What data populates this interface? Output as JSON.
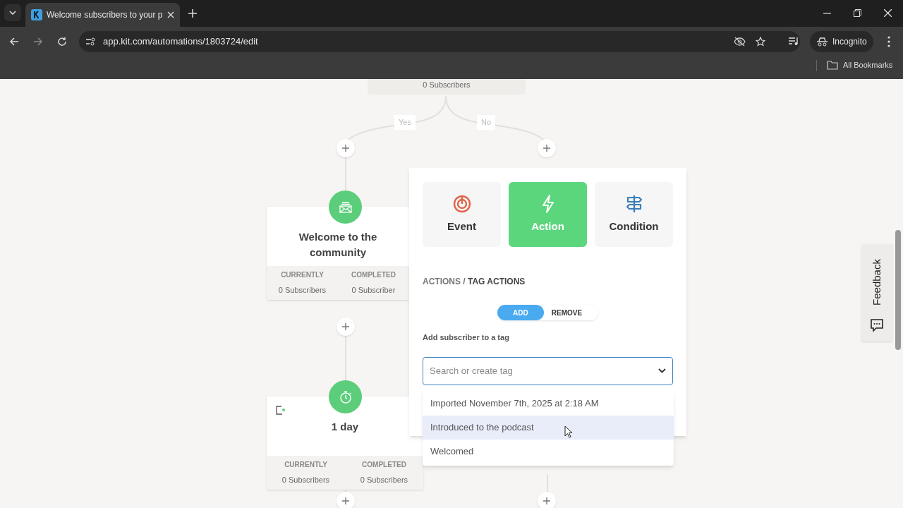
{
  "browser": {
    "tab_title": "Welcome subscribers to your p",
    "url": "app.kit.com/automations/1803724/edit",
    "profile": "Incognito",
    "bookmarks": "All Bookmarks"
  },
  "canvas": {
    "top_node_reading": "0 Subscribers",
    "branches": [
      "Yes",
      "No"
    ],
    "nodes": [
      {
        "kind": "email",
        "title": "Welcome to the community",
        "stats": [
          {
            "label": "CURRENTLY",
            "value": "0 Subscribers"
          },
          {
            "label": "COMPLETED",
            "value": "0 Subscriber"
          }
        ]
      },
      {
        "kind": "delay",
        "title": "1 day",
        "stats": [
          {
            "label": "CURRENTLY",
            "value": "0 Subscribers"
          },
          {
            "label": "COMPLETED",
            "value": "0 Subscribers"
          }
        ]
      }
    ]
  },
  "popover": {
    "step_types": [
      {
        "kind": "event",
        "label": "Event",
        "selected": false
      },
      {
        "kind": "action",
        "label": "Action",
        "selected": true
      },
      {
        "kind": "condition",
        "label": "Condition",
        "selected": false
      }
    ],
    "breadcrumb": "ACTIONS / **TAG ACTIONS**",
    "mode_toggle": [
      {
        "label": "ADD",
        "selected": true
      },
      {
        "label": "REMOVE",
        "selected": false
      }
    ],
    "field_label": "Add subscriber to a tag",
    "tag_select": {
      "placeholder": "Search or create tag"
    },
    "tag_options": [
      {
        "label": "Imported November 7th, 2025 at 2:18 AM",
        "highlighted": false
      },
      {
        "label": "Introduced to the podcast",
        "highlighted": true
      },
      {
        "label": "Welcomed",
        "highlighted": false
      }
    ]
  },
  "feedback": "Feedback"
}
